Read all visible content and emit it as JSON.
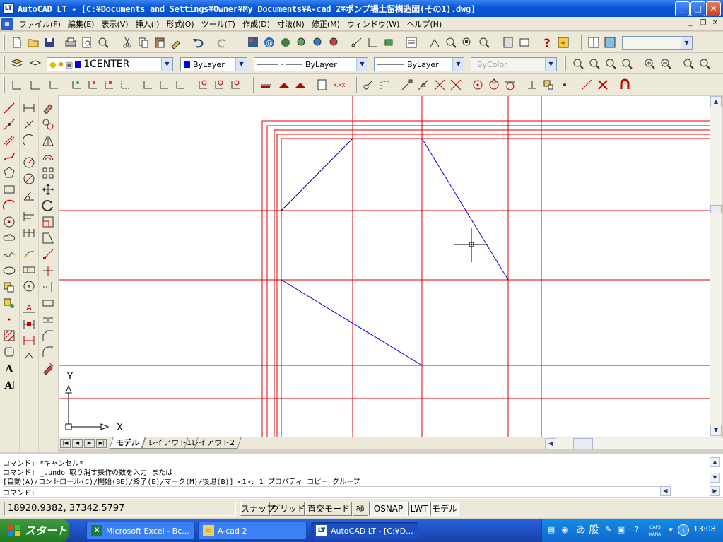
{
  "titlebar": {
    "icon": "LT",
    "title": "AutoCAD LT - [C:¥Documents and Settings¥Owner¥My Documents¥A-cad 2¥ポンプ場土留構造図(その1).dwg]",
    "min": "_",
    "max": "□",
    "close": "✕"
  },
  "menubar": {
    "items": [
      "ファイル(F)",
      "編集(E)",
      "表示(V)",
      "挿入(I)",
      "形式(O)",
      "ツール(T)",
      "作成(D)",
      "寸法(N)",
      "修正(M)",
      "ウィンドウ(W)",
      "ヘルプ(H)"
    ],
    "mdi_min": "_",
    "mdi_restore": "❐",
    "mdi_close": "✕"
  },
  "layers": {
    "current_layer": "1CENTER",
    "color": "ByLayer",
    "linetype": "ByLayer",
    "lineweight": "ByLayer",
    "plotstyle": "ByColor"
  },
  "colors": {
    "title_blue": "#0550c8",
    "grid_red": "#e00000",
    "line_blue": "#0000e0",
    "line_navy": "#000080",
    "layer_blue": "#0000ff"
  },
  "drawing": {
    "ucs_x": "X",
    "ucs_y": "Y"
  },
  "tabs": {
    "items": [
      "モデル",
      "レイアウト1",
      "レイアウト2"
    ],
    "active": "モデル"
  },
  "command": {
    "lines": [
      "コマンド: *キャンセル*",
      "コマンド: _.undo 取り消す操作の数を入力 または",
      "[自動(A)/コントロール(C)/開始(BE)/終了(E)/マーク(M)/後退(B)] <1>: 1 プロパティ コピー グループ",
      "コマンド:"
    ]
  },
  "status": {
    "coords": "18920.9382, 37342.5797",
    "buttons": [
      "スナップ",
      "グリッド",
      "直交モード",
      "極",
      "OSNAP",
      "LWT",
      "モデル"
    ],
    "on_buttons": [
      "OSNAP",
      "LWT",
      "モデル"
    ]
  },
  "taskbar": {
    "start": "スタート",
    "tasks": [
      "Microsoft Excel - Bc...",
      "A-cad 2",
      "AutoCAD LT - [C:¥D..."
    ],
    "active_task": "AutoCAD LT - [C:¥D...",
    "ime": "あ 般",
    "caps": "CAPS",
    "kana": "KANA",
    "clock": "13:08"
  }
}
